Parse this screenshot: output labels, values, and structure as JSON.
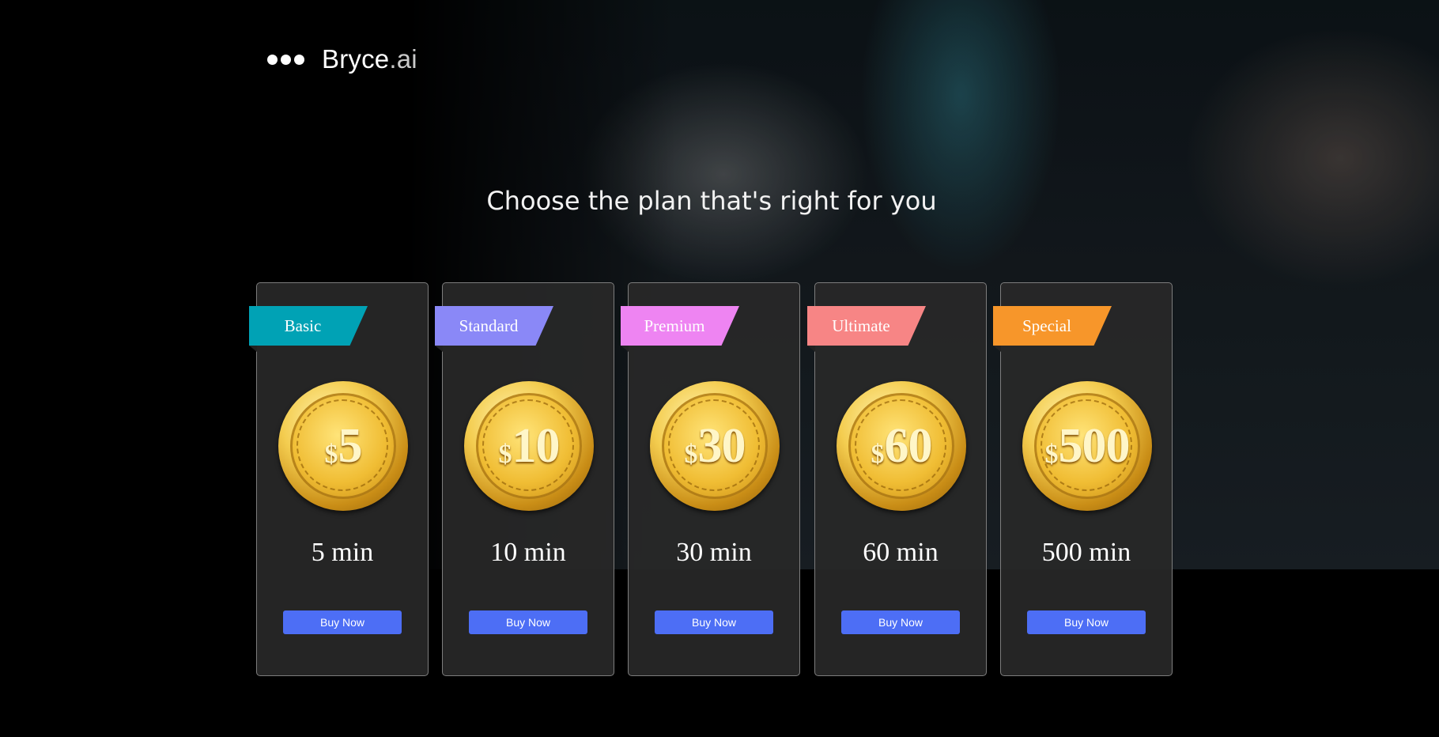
{
  "header": {
    "brand_name": "Bryce",
    "brand_suffix": ".ai"
  },
  "main": {
    "headline": "Choose the plan that's right for you"
  },
  "plans": [
    {
      "name": "Basic",
      "price_symbol": "$",
      "price": "5",
      "duration": "5 min",
      "buy_label": "Buy Now",
      "color": "#00a2b5"
    },
    {
      "name": "Standard",
      "price_symbol": "$",
      "price": "10",
      "duration": "10 min",
      "buy_label": "Buy Now",
      "color": "#8a88f7"
    },
    {
      "name": "Premium",
      "price_symbol": "$",
      "price": "30",
      "duration": "30 min",
      "buy_label": "Buy Now",
      "color": "#ee84f2"
    },
    {
      "name": "Ultimate",
      "price_symbol": "$",
      "price": "60",
      "duration": "60 min",
      "buy_label": "Buy Now",
      "color": "#f78585"
    },
    {
      "name": "Special",
      "price_symbol": "$",
      "price": "500",
      "duration": "500 min",
      "buy_label": "Buy Now",
      "color": "#f7962a"
    }
  ]
}
